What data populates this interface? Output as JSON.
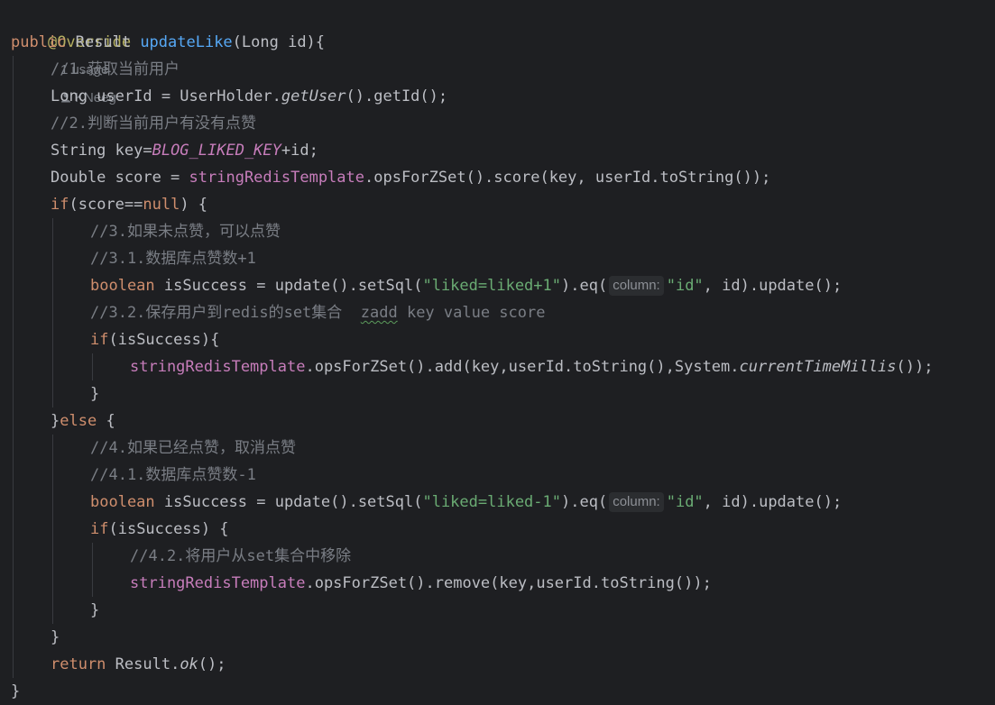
{
  "header": {
    "annotation": "@Override",
    "usages": "1 usage",
    "author": "KNeeg"
  },
  "code": {
    "l1": {
      "kw": "public",
      "type": " Result ",
      "fn": "updateLike",
      "rest": "(Long id){"
    },
    "l2": "//1.获取当前用户",
    "l3": {
      "a": "Long userId = UserHolder.",
      "m": "getUser",
      "b": "().getId();"
    },
    "l4": "//2.判断当前用户有没有点赞",
    "l5": {
      "a": "String key=",
      "c": "BLOG_LIKED_KEY",
      "b": "+id;"
    },
    "l6": {
      "a": "Double score = ",
      "f": "stringRedisTemplate",
      "b": ".opsForZSet().score(key, userId.toString());"
    },
    "l7": {
      "kw1": "if",
      "a": "(score==",
      "kw2": "null",
      "b": ") {"
    },
    "l8": "//3.如果未点赞，可以点赞",
    "l9": "//3.1.数据库点赞数+1",
    "l10": {
      "kw": "boolean",
      "a": " isSuccess = update().setSql(",
      "s1": "\"liked=liked+1\"",
      "b": ").eq(",
      "hint": "column:",
      "s2": "\"id\"",
      "c": ", id).update();"
    },
    "l11": {
      "c": "//3.2.保存用户到redis的set集合  ",
      "sq": "zadd",
      "c2": " key value score"
    },
    "l12": {
      "kw": "if",
      "a": "(isSuccess){"
    },
    "l13": {
      "f": "stringRedisTemplate",
      "a": ".opsForZSet().add(key,userId.toString(),System.",
      "m": "currentTimeMillis",
      "b": "());"
    },
    "l14": "}",
    "l15": {
      "a": "}",
      "kw": "else",
      "b": " {"
    },
    "l16": "//4.如果已经点赞，取消点赞",
    "l17": "//4.1.数据库点赞数-1",
    "l18": {
      "kw": "boolean",
      "a": " isSuccess = update().setSql(",
      "s1": "\"liked=liked-1\"",
      "b": ").eq(",
      "hint": "column:",
      "s2": "\"id\"",
      "c": ", id).update();"
    },
    "l19": {
      "kw": "if",
      "a": "(isSuccess) {"
    },
    "l20": "//4.2.将用户从set集合中移除",
    "l21": {
      "f": "stringRedisTemplate",
      "a": ".opsForZSet().remove(key,userId.toString());"
    },
    "l22": "}",
    "l23": "}",
    "l24": {
      "kw": "return",
      "a": " Result.",
      "m": "ok",
      "b": "();"
    },
    "l25": "}"
  },
  "colors": {
    "background": "#1e1f22",
    "keyword": "#cf8e6d",
    "function": "#56a8f5",
    "string": "#6aab73",
    "comment": "#7a7e85",
    "field": "#c77dbb",
    "annotation": "#b3ae60"
  },
  "icons": {
    "author": "user-icon"
  }
}
